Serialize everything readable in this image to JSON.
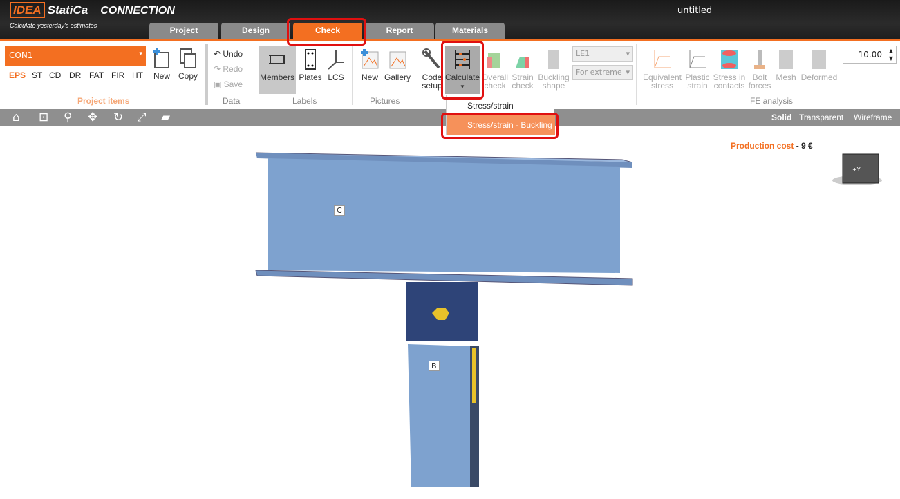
{
  "app": {
    "logo_brand": "IDEA",
    "logo_name": "StatiCa",
    "logo_product": "CONNECTION",
    "slogan": "Calculate yesterday's estimates",
    "title": "untitled"
  },
  "tabs": [
    "Project",
    "Design",
    "Check",
    "Report",
    "Materials"
  ],
  "active_tab": "Check",
  "project": {
    "selected": "CON1",
    "codes": [
      "EPS",
      "ST",
      "CD",
      "DR",
      "FAT",
      "FIR",
      "HT"
    ],
    "new": "New",
    "copy": "Copy",
    "group": "Project items"
  },
  "data": {
    "undo": "Undo",
    "redo": "Redo",
    "save": "Save",
    "group": "Data"
  },
  "labels": {
    "members": "Members",
    "plates": "Plates",
    "lcs": "LCS",
    "group": "Labels"
  },
  "pictures": {
    "new": "New",
    "gallery": "Gallery",
    "group": "Pictures"
  },
  "check": {
    "code_setup": "Code setup",
    "calculate": "Calculate",
    "overall": "Overall check",
    "strain": "Strain check",
    "buckling": "Buckling shape",
    "load_case": "LE1",
    "extreme": "For extreme"
  },
  "fe": {
    "equivalent": "Equivalent stress",
    "plastic": "Plastic strain",
    "contacts": "Stress in contacts",
    "bolt": "Bolt forces",
    "mesh": "Mesh",
    "deformed": "Deformed",
    "group": "FE analysis",
    "value": "10.00"
  },
  "calc_menu": [
    "Stress/strain",
    "Stress/strain - Buckling"
  ],
  "view_modes": [
    "Solid",
    "Transparent",
    "Wireframe"
  ],
  "cost": {
    "label": "Production cost",
    "value": "- 9 €"
  },
  "members": {
    "beam": "C",
    "column": "B"
  },
  "cube_label": "+Y",
  "colors": {
    "accent": "#f36f21",
    "highlight": "#e01010",
    "steel": "#7ea2cf"
  }
}
